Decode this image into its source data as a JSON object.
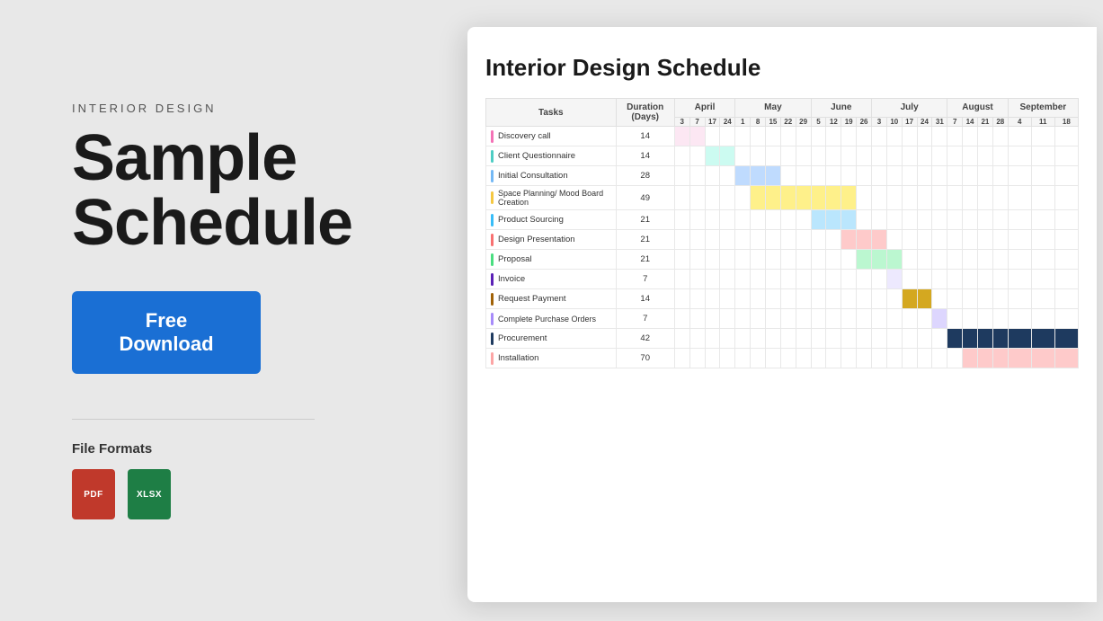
{
  "left": {
    "subtitle": "INTERIOR DESIGN",
    "title_line1": "Sample",
    "title_line2": "Schedule",
    "download_btn": "Free Download",
    "divider": true,
    "file_formats_label": "File Formats",
    "file_icons": [
      {
        "type": "PDF",
        "color": "#c0392b"
      },
      {
        "type": "XLSX",
        "color": "#1e7e45"
      }
    ]
  },
  "chart": {
    "title": "Interior Design Schedule",
    "months": [
      "April",
      "May",
      "June",
      "July",
      "August",
      "September"
    ],
    "col_tasks": "Tasks",
    "col_duration": "Duration (Days)",
    "tasks": [
      {
        "label": "Discovery call",
        "duration": 14,
        "color": "tc-pink"
      },
      {
        "label": "Client Questionnaire",
        "duration": 14,
        "color": "tc-teal"
      },
      {
        "label": "Initial Consultation",
        "duration": 28,
        "color": "tc-blue"
      },
      {
        "label": "Space Planning/ Mood Board Creation",
        "duration": 49,
        "color": "tc-yellow"
      },
      {
        "label": "Product Sourcing",
        "duration": 21,
        "color": "tc-cyan"
      },
      {
        "label": "Design Presentation",
        "duration": 21,
        "color": "tc-coral"
      },
      {
        "label": "Proposal",
        "duration": 21,
        "color": "tc-green"
      },
      {
        "label": "Invoice",
        "duration": 7,
        "color": "tc-purple"
      },
      {
        "label": "Request Payment",
        "duration": 14,
        "color": "tc-olive"
      },
      {
        "label": "Complete Purchase Orders",
        "duration": 7,
        "color": "tc-lavender"
      },
      {
        "label": "Procurement",
        "duration": 42,
        "color": "tc-navy"
      },
      {
        "label": "Installation",
        "duration": 70,
        "color": "tc-salmon"
      }
    ]
  }
}
